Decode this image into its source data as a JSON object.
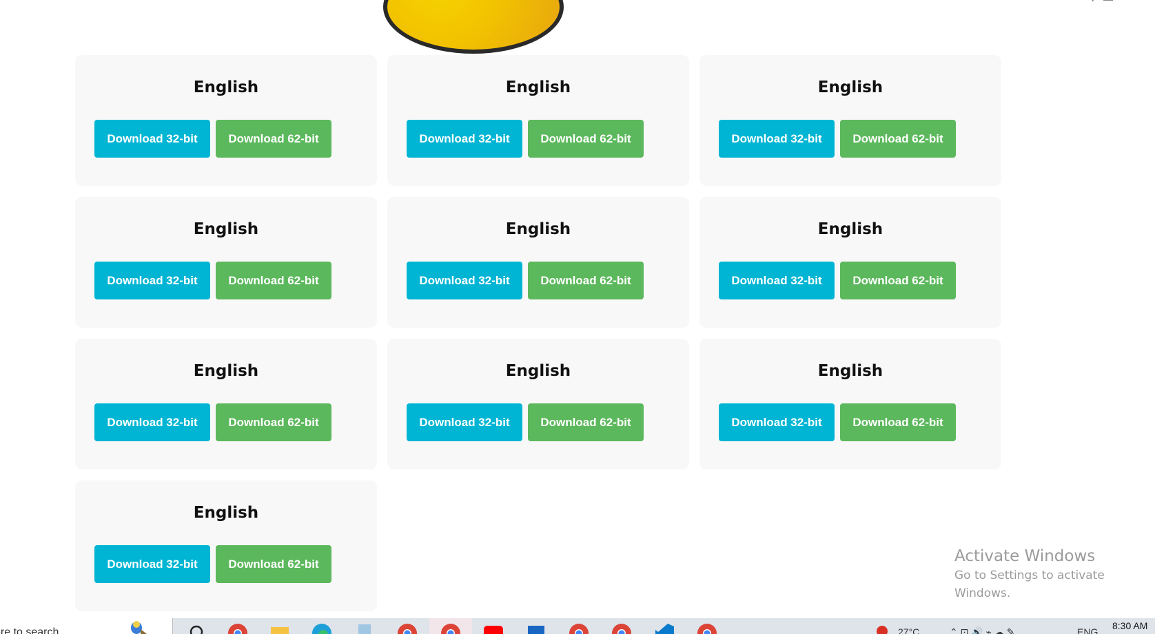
{
  "cards": [
    {
      "title": "English",
      "btn32": "Download 32-bit",
      "btn64": "Download 62-bit"
    },
    {
      "title": "English",
      "btn32": "Download 32-bit",
      "btn64": "Download 62-bit"
    },
    {
      "title": "English",
      "btn32": "Download 32-bit",
      "btn64": "Download 62-bit"
    },
    {
      "title": "English",
      "btn32": "Download 32-bit",
      "btn64": "Download 62-bit"
    },
    {
      "title": "English",
      "btn32": "Download 32-bit",
      "btn64": "Download 62-bit"
    },
    {
      "title": "English",
      "btn32": "Download 32-bit",
      "btn64": "Download 62-bit"
    },
    {
      "title": "English",
      "btn32": "Download 32-bit",
      "btn64": "Download 62-bit"
    },
    {
      "title": "English",
      "btn32": "Download 32-bit",
      "btn64": "Download 62-bit"
    },
    {
      "title": "English",
      "btn32": "Download 32-bit",
      "btn64": "Download 62-bit"
    },
    {
      "title": "English",
      "btn32": "Download 32-bit",
      "btn64": "Download 62-bit"
    }
  ],
  "colors": {
    "button_32": "#00b5d3",
    "button_64": "#5cb85c",
    "card_background": "#f8f8f8",
    "logo_fill": "#f2c200"
  },
  "watermark": {
    "title": "Activate Windows",
    "subtitle": "Go to Settings to activate Windows."
  },
  "taskbar": {
    "search_text": "ere to search",
    "weather": "27°C",
    "language": "ENG",
    "time": "8:30 AM",
    "icons": [
      "search-icon",
      "chrome-icon",
      "file-explorer-icon",
      "edge-icon",
      "notepad-icon",
      "chrome-icon",
      "chrome-icon",
      "youtube-icon",
      "store-icon",
      "chrome-icon",
      "chrome-icon",
      "vscode-icon",
      "chrome-icon"
    ]
  }
}
